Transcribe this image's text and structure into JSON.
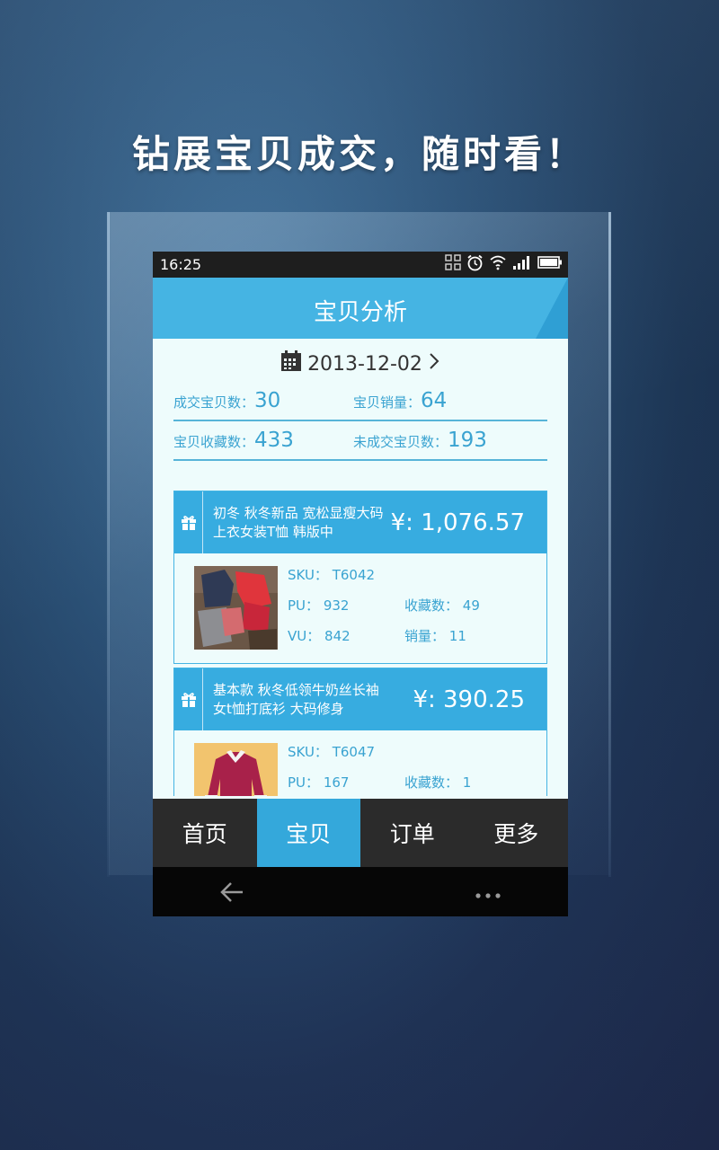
{
  "promo": {
    "headline": "钻展宝贝成交，随时看！"
  },
  "statusbar": {
    "time": "16:25"
  },
  "header": {
    "title": "宝贝分析"
  },
  "date": {
    "value": "2013-12-02"
  },
  "stats": {
    "deal_items_label": "成交宝贝数：",
    "deal_items_value": "30",
    "sales_label": "宝贝销量：",
    "sales_value": "64",
    "favorites_label": "宝贝收藏数：",
    "favorites_value": "433",
    "undealt_label": "未成交宝贝数：",
    "undealt_value": "193"
  },
  "items": [
    {
      "name": "初冬 秋冬新品 宽松显瘦大码上衣女装T恤 韩版中",
      "price": "¥: 1,076.57",
      "sku_label": "SKU：",
      "sku": "T6042",
      "pu_label": "PU：",
      "pu": "932",
      "fav_label": "收藏数：",
      "fav": "49",
      "vu_label": "VU：",
      "vu": "842",
      "sales_label": "销量：",
      "sales": "11"
    },
    {
      "name": "基本款 秋冬低领牛奶丝长袖女t恤打底衫 大码修身",
      "price": "¥: 390.25",
      "sku_label": "SKU：",
      "sku": "T6047",
      "pu_label": "PU：",
      "pu": "167",
      "fav_label": "收藏数：",
      "fav": "1"
    }
  ],
  "tabs": [
    {
      "label": "首页"
    },
    {
      "label": "宝贝"
    },
    {
      "label": "订单"
    },
    {
      "label": "更多"
    }
  ],
  "colors": {
    "accent": "#37ace0",
    "header": "#45b4e3",
    "stat_text": "#3aa3d1",
    "content_bg": "#eefcfc"
  },
  "icons": [
    "calendar-icon",
    "chevron-right-icon",
    "gift-icon",
    "back-arrow-icon",
    "more-dots-icon",
    "wifi-icon",
    "alarm-icon",
    "signal-icon",
    "battery-icon",
    "qr-icon"
  ]
}
